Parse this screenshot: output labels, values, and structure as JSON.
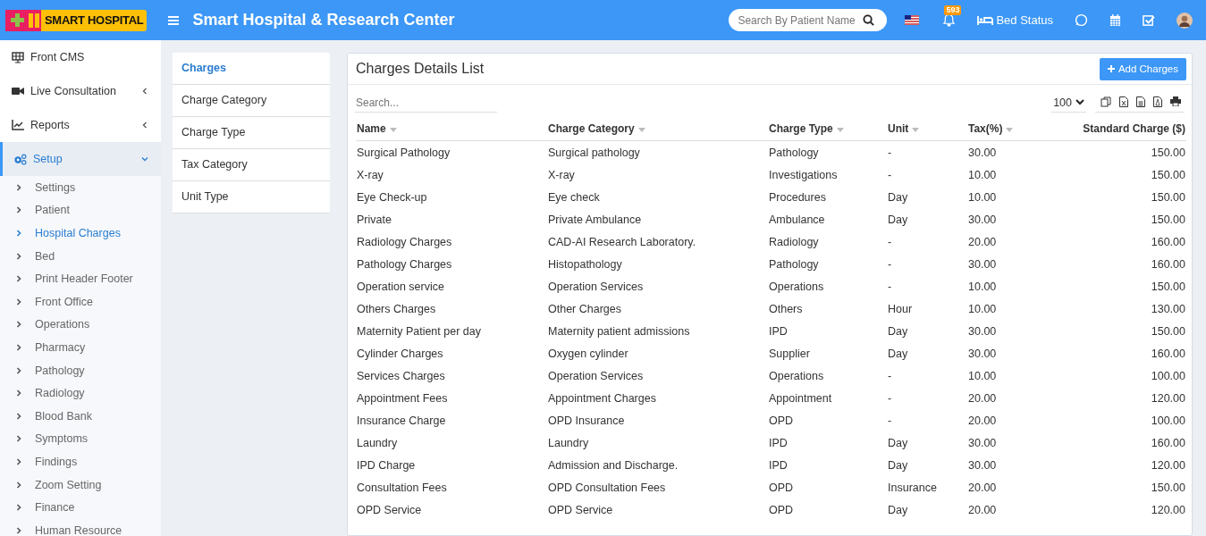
{
  "header": {
    "logo_text": "SMART HOSPITAL",
    "title": "Smart Hospital & Research Center",
    "search": {
      "placeholder": "Search By Patient Name"
    },
    "notification_count": "593",
    "bed_status": "Bed Status"
  },
  "sidebar": {
    "items": [
      {
        "label": "Front CMS",
        "kind": "monitor",
        "selected": false
      },
      {
        "label": "Live Consultation",
        "kind": "video",
        "selected": false,
        "expanded": false
      },
      {
        "label": "Reports",
        "kind": "chart",
        "selected": false,
        "expanded": false
      },
      {
        "label": "Setup",
        "kind": "gears",
        "selected": true,
        "expanded": true,
        "children": [
          {
            "label": "Settings",
            "selected": false
          },
          {
            "label": "Patient",
            "selected": false
          },
          {
            "label": "Hospital Charges",
            "selected": true
          },
          {
            "label": "Bed",
            "selected": false
          },
          {
            "label": "Print Header Footer",
            "selected": false
          },
          {
            "label": "Front Office",
            "selected": false
          },
          {
            "label": "Operations",
            "selected": false
          },
          {
            "label": "Pharmacy",
            "selected": false
          },
          {
            "label": "Pathology",
            "selected": false
          },
          {
            "label": "Radiology",
            "selected": false
          },
          {
            "label": "Blood Bank",
            "selected": false
          },
          {
            "label": "Symptoms",
            "selected": false
          },
          {
            "label": "Findings",
            "selected": false
          },
          {
            "label": "Zoom Setting",
            "selected": false
          },
          {
            "label": "Finance",
            "selected": false
          },
          {
            "label": "Human Resource",
            "selected": false
          }
        ]
      }
    ]
  },
  "submenu": [
    {
      "label": "Charges",
      "selected": true
    },
    {
      "label": "Charge Category",
      "selected": false
    },
    {
      "label": "Charge Type",
      "selected": false
    },
    {
      "label": "Tax Category",
      "selected": false
    },
    {
      "label": "Unit Type",
      "selected": false
    }
  ],
  "card": {
    "title": "Charges Details List",
    "add_button": "Add Charges",
    "search": {
      "placeholder": "Search..."
    },
    "page_size": "100",
    "table": {
      "columns": [
        "Name",
        "Charge Category",
        "Charge Type",
        "Unit",
        "Tax(%)",
        "Standard Charge ($)"
      ],
      "rows": [
        [
          "Surgical Pathology",
          "Surgical pathology",
          "Pathology",
          "-",
          "30.00",
          "150.00"
        ],
        [
          "X-ray",
          "X-ray",
          "Investigations",
          "-",
          "10.00",
          "150.00"
        ],
        [
          "Eye Check-up",
          "Eye check",
          "Procedures",
          "Day",
          "10.00",
          "150.00"
        ],
        [
          "Private",
          "Private Ambulance",
          "Ambulance",
          "Day",
          "30.00",
          "150.00"
        ],
        [
          "Radiology Charges",
          "CAD-AI Research Laboratory.",
          "Radiology",
          "-",
          "20.00",
          "160.00"
        ],
        [
          "Pathology Charges",
          "Histopathology",
          "Pathology",
          "-",
          "30.00",
          "160.00"
        ],
        [
          "Operation service",
          "Operation Services",
          "Operations",
          "-",
          "10.00",
          "150.00"
        ],
        [
          "Others Charges",
          "Other Charges",
          "Others",
          "Hour",
          "10.00",
          "130.00"
        ],
        [
          "Maternity Patient per day",
          "Maternity patient admissions",
          "IPD",
          "Day",
          "30.00",
          "150.00"
        ],
        [
          "Cylinder Charges",
          "Oxygen cylinder",
          "Supplier",
          "Day",
          "30.00",
          "160.00"
        ],
        [
          "Services Charges",
          "Operation Services",
          "Operations",
          "-",
          "10.00",
          "100.00"
        ],
        [
          "Appointment Fees",
          "Appointment Charges",
          "Appointment",
          "-",
          "20.00",
          "120.00"
        ],
        [
          "Insurance Charge",
          "OPD Insurance",
          "OPD",
          "-",
          "20.00",
          "100.00"
        ],
        [
          "Laundry",
          "Laundry",
          "IPD",
          "Day",
          "30.00",
          "160.00"
        ],
        [
          "IPD Charge",
          "Admission and Discharge.",
          "IPD",
          "Day",
          "30.00",
          "120.00"
        ],
        [
          "Consultation Fees",
          "OPD Consultation Fees",
          "OPD",
          "Insurance",
          "20.00",
          "150.00"
        ],
        [
          "OPD Service",
          "OPD Service",
          "OPD",
          "Day",
          "20.00",
          "120.00"
        ]
      ]
    }
  }
}
